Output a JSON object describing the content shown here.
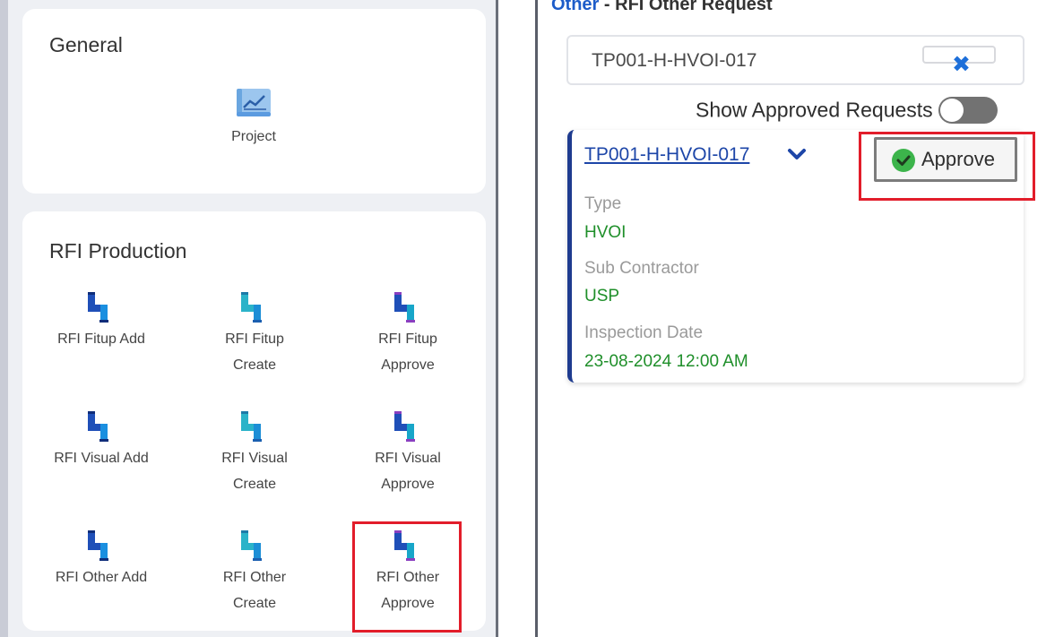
{
  "colors": {
    "accent_blue": "#1d5cc9",
    "highlight_red": "#e21d2a",
    "value_green": "#1f8f2a",
    "card_bar": "#1e3b8f"
  },
  "left": {
    "general": {
      "title": "General",
      "tiles": [
        {
          "label_lines": [
            "Project"
          ],
          "icon": "project-chart-icon"
        }
      ]
    },
    "rfi_production": {
      "title": "RFI Production",
      "tiles": [
        {
          "label_lines": [
            "RFI Fitup Add"
          ],
          "icon": "pipe-elbow-icon"
        },
        {
          "label_lines": [
            "RFI Fitup",
            "Create"
          ],
          "icon": "pipe-elbow-icon"
        },
        {
          "label_lines": [
            "RFI Fitup",
            "Approve"
          ],
          "icon": "pipe-elbow-icon"
        },
        {
          "label_lines": [
            "RFI Visual Add"
          ],
          "icon": "pipe-elbow-icon"
        },
        {
          "label_lines": [
            "RFI Visual",
            "Create"
          ],
          "icon": "pipe-elbow-icon"
        },
        {
          "label_lines": [
            "RFI Visual",
            "Approve"
          ],
          "icon": "pipe-elbow-icon"
        },
        {
          "label_lines": [
            "RFI Other Add"
          ],
          "icon": "pipe-elbow-icon"
        },
        {
          "label_lines": [
            "RFI Other",
            "Create"
          ],
          "icon": "pipe-elbow-icon"
        },
        {
          "label_lines": [
            "RFI Other",
            "Approve"
          ],
          "icon": "pipe-elbow-icon"
        }
      ]
    }
  },
  "right": {
    "header": {
      "category": "Other",
      "separator": " - ",
      "title": "RFI Other Request"
    },
    "search": {
      "value": "TP001-H-HVOI-017",
      "clear_icon": "close-icon"
    },
    "toggle": {
      "label": "Show Approved Requests",
      "on": false
    },
    "request": {
      "id": "TP001-H-HVOI-017",
      "approve_label": "Approve",
      "fields": [
        {
          "label": "Type",
          "value": "HVOI"
        },
        {
          "label": "Sub Contractor",
          "value": "USP"
        },
        {
          "label": "Inspection Date",
          "value": "23-08-2024 12:00 AM"
        }
      ]
    }
  }
}
